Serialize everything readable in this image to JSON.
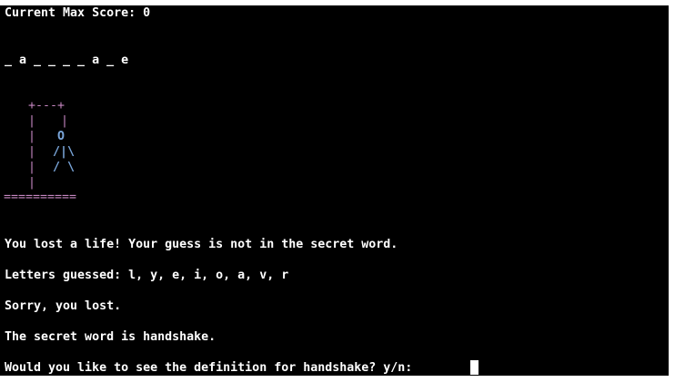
{
  "header": {
    "max_score_label": "Current Max Score: 0"
  },
  "word_progress": "_ a _ _ _ _ a _ e",
  "gallows": {
    "top": "+---+",
    "rope_left": "|",
    "rope_right": "|",
    "pole": "|",
    "head": "O",
    "body_line": "/|\\",
    "legs_line": "/ \\",
    "base": "=========="
  },
  "messages": {
    "lost_life": "You lost a life! Your guess is not in the secret word.",
    "letters_guessed": "Letters guessed: l, y, e, i, o, a, v, r",
    "sorry": "Sorry, you lost.",
    "secret_word": "The secret word is handshake.",
    "prompt": "Would you like to see the definition for handshake? y/n: "
  },
  "colors": {
    "background": "#000000",
    "text": "#ffffff",
    "gallows": "#c586c0",
    "figure": "#7aa6da"
  }
}
